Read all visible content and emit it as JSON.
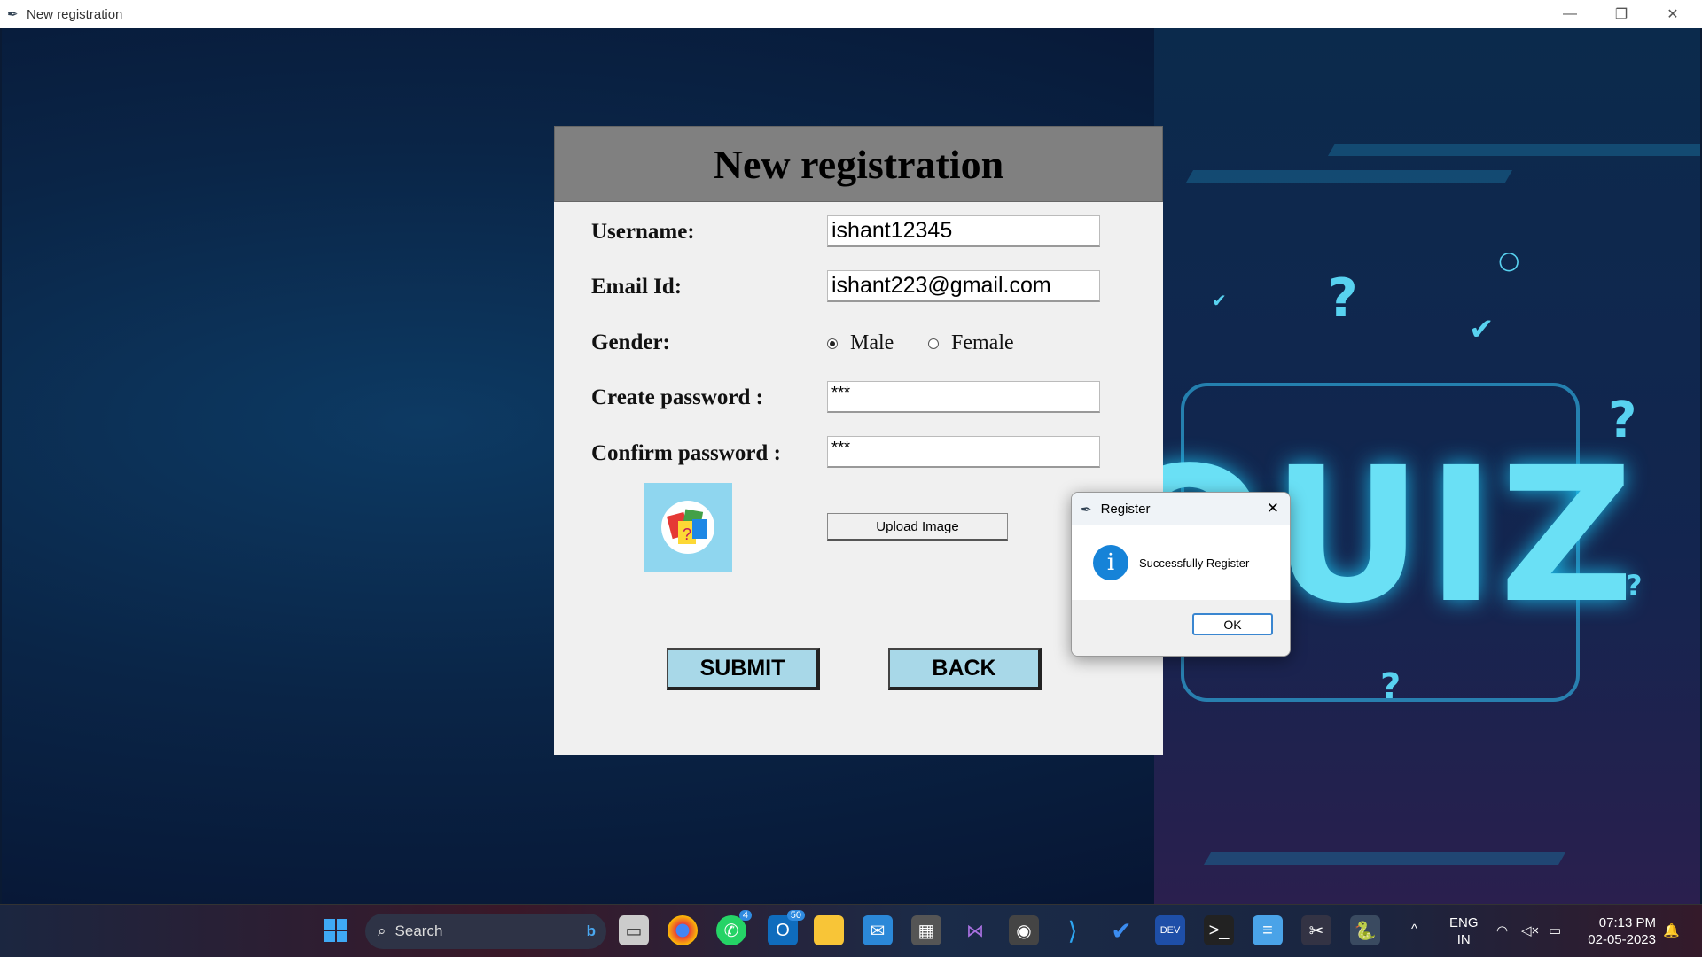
{
  "window": {
    "title": "New registration"
  },
  "background": {
    "graphic_text": "QUIZ"
  },
  "form": {
    "title": "New registration",
    "username_label": "Username:",
    "username_value": "ishant12345",
    "email_label": "Email Id:",
    "email_value": "ishant223@gmail.com",
    "gender_label": "Gender:",
    "gender_options": [
      "Male",
      "Female"
    ],
    "gender_selected": "Male",
    "create_password_label": "Create password :",
    "create_password_value": "***",
    "confirm_password_label": "Confirm password :",
    "confirm_password_value": "***",
    "upload_label": "Upload Image",
    "submit_label": "SUBMIT",
    "back_label": "BACK"
  },
  "dialog": {
    "title": "Register",
    "message": "Successfully Register",
    "ok_label": "OK"
  },
  "taskbar": {
    "search_placeholder": "Search",
    "whatsapp_badge": "4",
    "outlook_badge": "50",
    "lang": "ENG",
    "region": "IN",
    "time": "07:13 PM",
    "date": "02-05-2023"
  }
}
